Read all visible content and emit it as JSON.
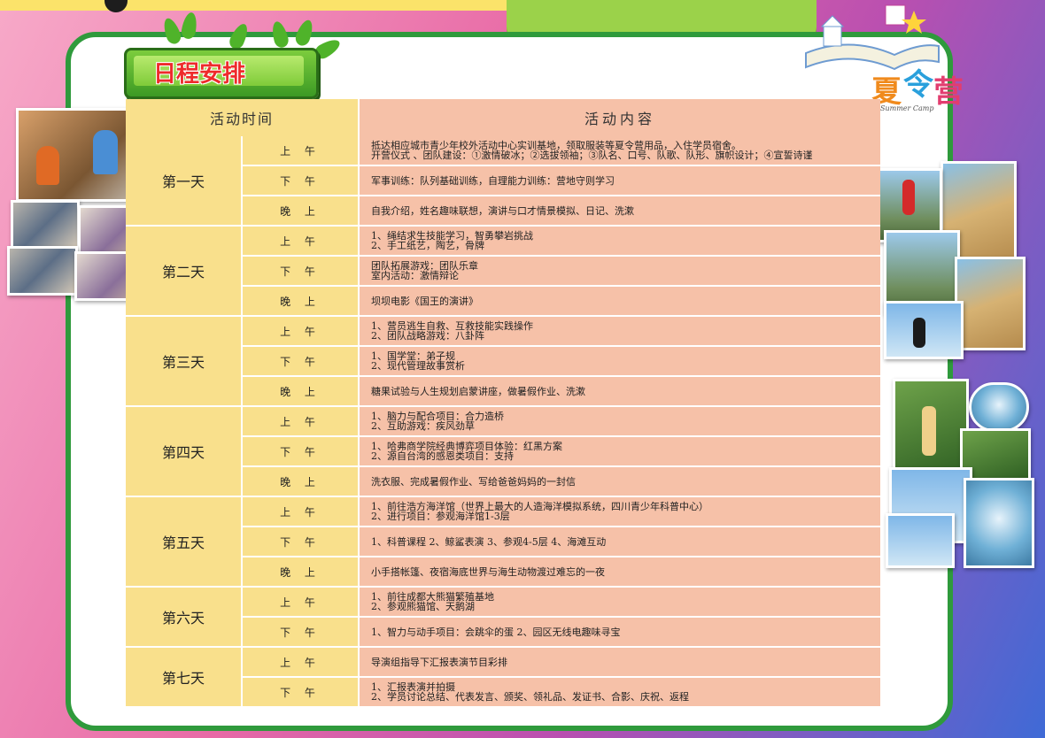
{
  "header": {
    "title": "日程安排"
  },
  "logo": {
    "glyph_1": "夏",
    "glyph_2": "令",
    "glyph_3": "营",
    "subtitle": "Summer Camp"
  },
  "table": {
    "header_time": "活动时间",
    "header_content": "活动内容",
    "days": [
      {
        "day": "第一天",
        "rows": [
          {
            "period": "上 午",
            "content": "抵达相应城市青少年校外活动中心实训基地，领取服装等夏令营用品，入住学员宿舍。\n开营仪式 、团队建设：①激情破冰；②选拔领袖；③队名、口号、队歌、队形、旗帜设计；④宣誓诗谨"
          },
          {
            "period": "下 午",
            "content": "军事训练：队列基础训练，自理能力训练：营地守则学习"
          },
          {
            "period": "晚 上",
            "content": "自我介绍，姓名趣味联想，演讲与口才情景模拟、日记、洗漱"
          }
        ]
      },
      {
        "day": "第二天",
        "rows": [
          {
            "period": "上 午",
            "content": "1、绳结求生技能学习，智勇攀岩挑战\n2、手工纸艺，陶艺，骨牌"
          },
          {
            "period": "下 午",
            "content": "团队拓展游戏：团队乐章\n室内活动：激情辩论"
          },
          {
            "period": "晚 上",
            "content": "坝坝电影《国王的演讲》"
          }
        ]
      },
      {
        "day": "第三天",
        "rows": [
          {
            "period": "上 午",
            "content": "1、营员逃生自救、互救技能实践操作\n2、团队战略游戏：八卦阵"
          },
          {
            "period": "下 午",
            "content": "1、国学堂：弟子规\n2、现代管理故事赏析"
          },
          {
            "period": "晚 上",
            "content": "糖果试验与人生规划启蒙讲座，做暑假作业、洗漱"
          }
        ]
      },
      {
        "day": "第四天",
        "rows": [
          {
            "period": "上 午",
            "content": "1、脑力与配合项目：合力造桥\n2、互助游戏：疾风劲草"
          },
          {
            "period": "下 午",
            "content": "1、哈弗商学院经典博弈项目体验：红黑方案\n2、源自台湾的感恩类项目：支持"
          },
          {
            "period": "晚 上",
            "content": "洗衣服、完成暑假作业、写给爸爸妈妈的一封信"
          }
        ]
      },
      {
        "day": "第五天",
        "rows": [
          {
            "period": "上 午",
            "content": "1、前往浩方海洋馆（世界上最大的人造海洋模拟系统，四川青少年科普中心）\n2、进行项目：参观海洋馆1-3层"
          },
          {
            "period": "下 午",
            "content": "1、科普课程  2、鲸鲨表演  3、参观4-5层  4、海滩互动"
          },
          {
            "period": "晚 上",
            "content": "小手搭帐篷、夜宿海底世界与海生动物渡过难忘的一夜"
          }
        ]
      },
      {
        "day": "第六天",
        "rows": [
          {
            "period": "上 午",
            "content": "1、前往成都大熊猫繁殖基地\n2、参观熊猫馆、天鹅湖"
          },
          {
            "period": "下 午",
            "content": "1、智力与动手项目：会跳伞的蛋          2、园区无线电趣味寻宝"
          }
        ]
      },
      {
        "day": "第七天",
        "rows": [
          {
            "period": "上 午",
            "content": "导演组指导下汇报表演节目彩排"
          },
          {
            "period": "下 午",
            "content": "1、汇报表演并拍摄\n2、学员讨论总结、代表发言、颁奖、领礼品、发证书、合影、庆祝、返程"
          }
        ]
      }
    ]
  },
  "colors": {
    "time_column": "#f9e08c",
    "content_column": "#f6c1a8",
    "frame_green": "#2f9a3c",
    "title_red": "#ee2b2b"
  }
}
